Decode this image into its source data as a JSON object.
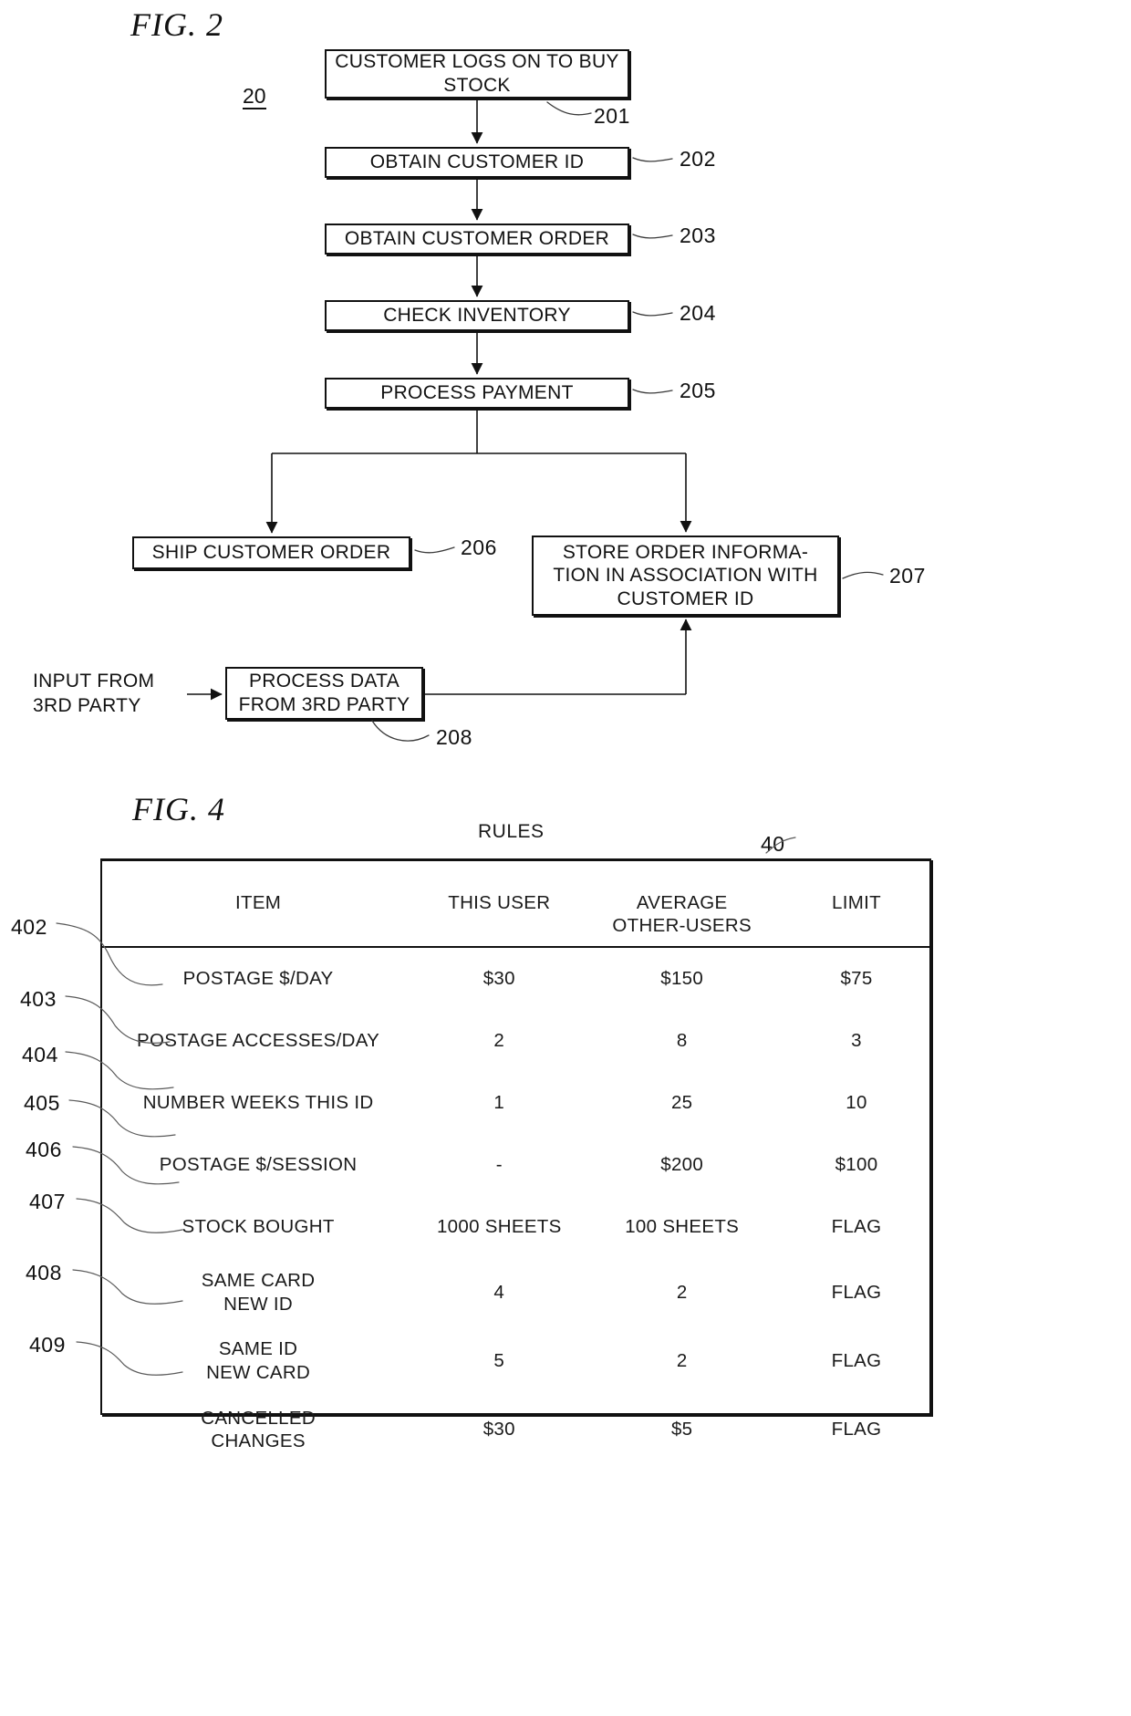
{
  "figures": {
    "fig2": {
      "title": "FIG. 2",
      "diagram_ref": "20",
      "steps": [
        {
          "id": "201",
          "label": "CUSTOMER LOGS ON\nTO BUY STOCK",
          "ref": "201"
        },
        {
          "id": "202",
          "label": "OBTAIN CUSTOMER ID",
          "ref": "202"
        },
        {
          "id": "203",
          "label": "OBTAIN CUSTOMER ORDER",
          "ref": "203"
        },
        {
          "id": "204",
          "label": "CHECK INVENTORY",
          "ref": "204"
        },
        {
          "id": "205",
          "label": "PROCESS PAYMENT",
          "ref": "205"
        },
        {
          "id": "206",
          "label": "SHIP CUSTOMER ORDER",
          "ref": "206"
        },
        {
          "id": "207",
          "label": "STORE ORDER INFORMA-\nTION IN ASSOCIATION\nWITH CUSTOMER ID",
          "ref": "207"
        },
        {
          "id": "208",
          "label": "PROCESS DATA\nFROM 3RD PARTY",
          "ref": "208"
        }
      ],
      "external_input_label": "INPUT FROM\n3RD PARTY"
    },
    "fig4": {
      "title": "FIG. 4",
      "table_caption": "RULES",
      "table_ref": "40",
      "columns": [
        "ITEM",
        "THIS USER",
        "AVERAGE\nOTHER-USERS",
        "LIMIT"
      ],
      "rows": [
        {
          "ref": "402",
          "item": "POSTAGE $/DAY",
          "this_user": "$30",
          "average_other_users": "$150",
          "limit": "$75"
        },
        {
          "ref": "403",
          "item": "POSTAGE ACCESSES/DAY",
          "this_user": "2",
          "average_other_users": "8",
          "limit": "3"
        },
        {
          "ref": "404",
          "item": "NUMBER WEEKS THIS ID",
          "this_user": "1",
          "average_other_users": "25",
          "limit": "10"
        },
        {
          "ref": "405",
          "item": "POSTAGE $/SESSION",
          "this_user": "-",
          "average_other_users": "$200",
          "limit": "$100"
        },
        {
          "ref": "406",
          "item": "STOCK BOUGHT",
          "this_user": "1000 SHEETS",
          "average_other_users": "100 SHEETS",
          "limit": "FLAG"
        },
        {
          "ref": "407",
          "item": "SAME CARD\nNEW ID",
          "this_user": "4",
          "average_other_users": "2",
          "limit": "FLAG"
        },
        {
          "ref": "408",
          "item": "SAME ID\nNEW CARD",
          "this_user": "5",
          "average_other_users": "2",
          "limit": "FLAG"
        },
        {
          "ref": "409",
          "item": "CANCELLED\nCHANGES",
          "this_user": "$30",
          "average_other_users": "$5",
          "limit": "FLAG"
        }
      ]
    }
  }
}
